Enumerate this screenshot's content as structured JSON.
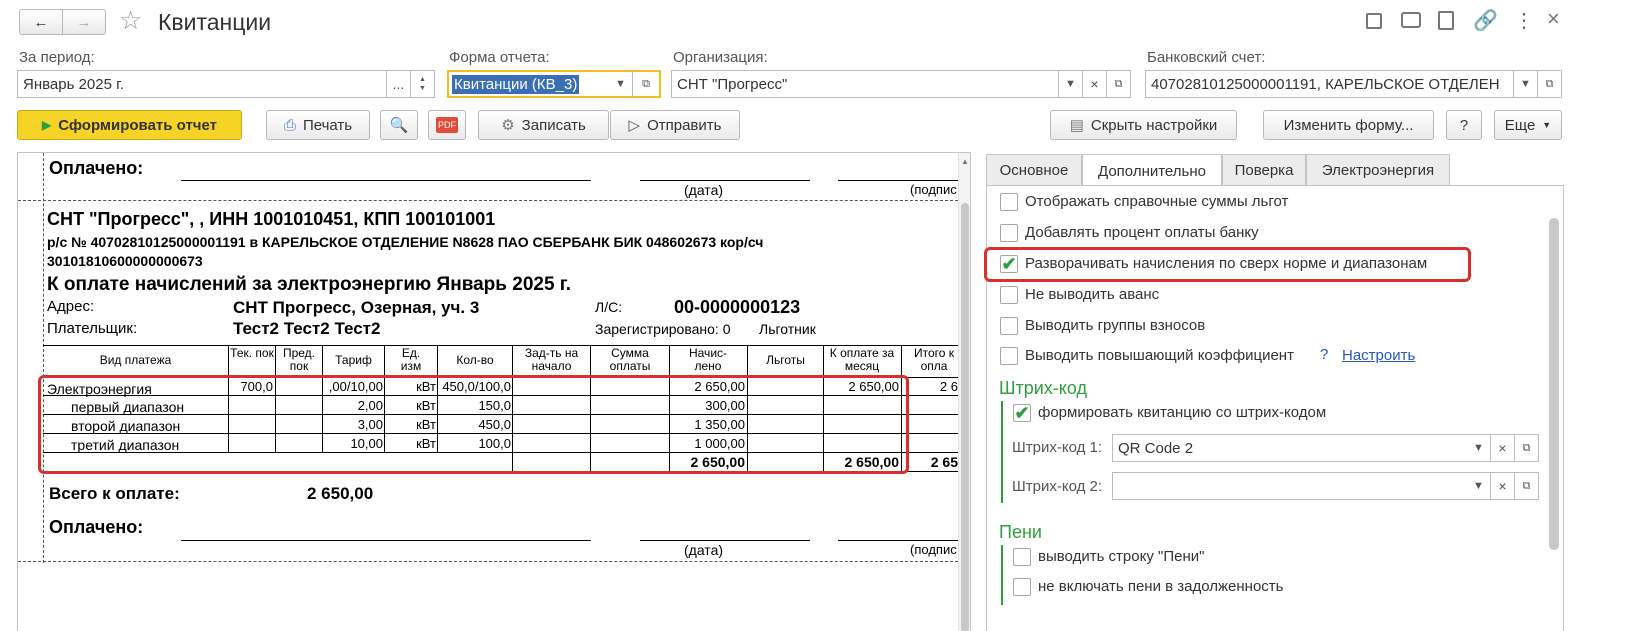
{
  "window": {
    "title": "Квитанции"
  },
  "header": {
    "period_label": "За период:",
    "period_value": "Январь 2025 г.",
    "period_more": "...",
    "form_label": "Форма отчета:",
    "form_value": "Квитанции (КВ_3)",
    "org_label": "Организация:",
    "org_value": "СНТ \"Прогресс\"",
    "bank_label": "Банковский счет:",
    "bank_value": "40702810125000001191, КАРЕЛЬСКОЕ ОТДЕЛЕН"
  },
  "toolbar": {
    "generate": "Сформировать отчет",
    "print": "Печать",
    "pdf": "PDF",
    "save": "Записать",
    "send": "Отправить",
    "hide_settings": "Скрыть настройки",
    "change_form": "Изменить форму...",
    "help": "?",
    "more": "Еще"
  },
  "report": {
    "paid_label": "Оплачено:",
    "date_caption": "(дата)",
    "sign_caption": "(подпис",
    "org_line": "СНТ \"Прогресс\", , ИНН 1001010451, КПП 100101001",
    "bank_line1": "р/с № 40702810125000001191 в КАРЕЛЬСКОЕ ОТДЕЛЕНИЕ N8628 ПАО СБЕРБАНК БИК 048602673 кор/сч",
    "bank_line2": "30101810600000000673",
    "title": "К оплате начислений за электроэнергию Январь 2025 г.",
    "address_label": "Адрес:",
    "address_value": "СНТ Прогресс, Озерная, уч. 3",
    "account_label": "Л/С:",
    "account_value": "00-0000000123",
    "payer_label": "Плательщик:",
    "payer_value": "Тест2 Тест2 Тест2",
    "registered": "Зарегистрировано: 0",
    "benefit": "Льготник",
    "columns": [
      "Вид платежа",
      "Тек. пок",
      "Пред. пок",
      "Тариф",
      "Ед. изм",
      "Кол-во",
      "Зад-ть на начало",
      "Сумма оплаты",
      "Начис-лено",
      "Льготы",
      "К оплате за месяц",
      "Итого к опла"
    ],
    "rows": [
      {
        "name": "Электроэнергия",
        "cur": "700,0",
        "prev": "",
        "tariff": ",00/10,00",
        "unit": "кВт",
        "qty": "450,0/100,0",
        "debt": "",
        "paid": "",
        "accrued": "2 650,00",
        "benefits": "",
        "due": "2 650,00",
        "total": "2 6"
      },
      {
        "name": "первый диапазон",
        "cur": "",
        "prev": "",
        "tariff": "2,00",
        "unit": "кВт",
        "qty": "150,0",
        "debt": "",
        "paid": "",
        "accrued": "300,00",
        "benefits": "",
        "due": "",
        "total": ""
      },
      {
        "name": "второй диапазон",
        "cur": "",
        "prev": "",
        "tariff": "3,00",
        "unit": "кВт",
        "qty": "450,0",
        "debt": "",
        "paid": "",
        "accrued": "1 350,00",
        "benefits": "",
        "due": "",
        "total": ""
      },
      {
        "name": "третий диапазон",
        "cur": "",
        "prev": "",
        "tariff": "10,00",
        "unit": "кВт",
        "qty": "100,0",
        "debt": "",
        "paid": "",
        "accrued": "1 000,00",
        "benefits": "",
        "due": "",
        "total": ""
      }
    ],
    "totals": {
      "accrued": "2 650,00",
      "due": "2 650,00",
      "total": "2 65"
    },
    "total_label": "Всего к оплате:",
    "total_value": "2 650,00"
  },
  "settings": {
    "tabs": [
      "Основное",
      "Дополнительно",
      "Поверка",
      "Электроэнергия"
    ],
    "options": [
      {
        "label": "Отображать справочные суммы льгот",
        "checked": false
      },
      {
        "label": "Добавлять процент оплаты банку",
        "checked": false
      },
      {
        "label": "Разворачивать начисления по сверх норме и диапазонам",
        "checked": true
      },
      {
        "label": "Не выводить аванс",
        "checked": false
      },
      {
        "label": "Выводить группы взносов",
        "checked": false
      },
      {
        "label": "Выводить повышающий коэффициент",
        "checked": false
      }
    ],
    "help_mark": "?",
    "configure_link": "Настроить",
    "barcode_section": "Штрих-код",
    "barcode_option": "формировать квитанцию со штрих-кодом",
    "barcode1_label": "Штрих-код 1:",
    "barcode1_value": "QR Code 2",
    "barcode2_label": "Штрих-код 2:",
    "barcode2_value": "",
    "penalty_section": "Пени",
    "penalty_options": [
      "выводить строку \"Пени\"",
      "не включать пени в задолженность"
    ]
  },
  "colors": {
    "accent_green": "#2e9e3e",
    "highlight_red": "#d9302b",
    "primary_yellow": "#f5d327",
    "link_blue": "#2355c4"
  }
}
